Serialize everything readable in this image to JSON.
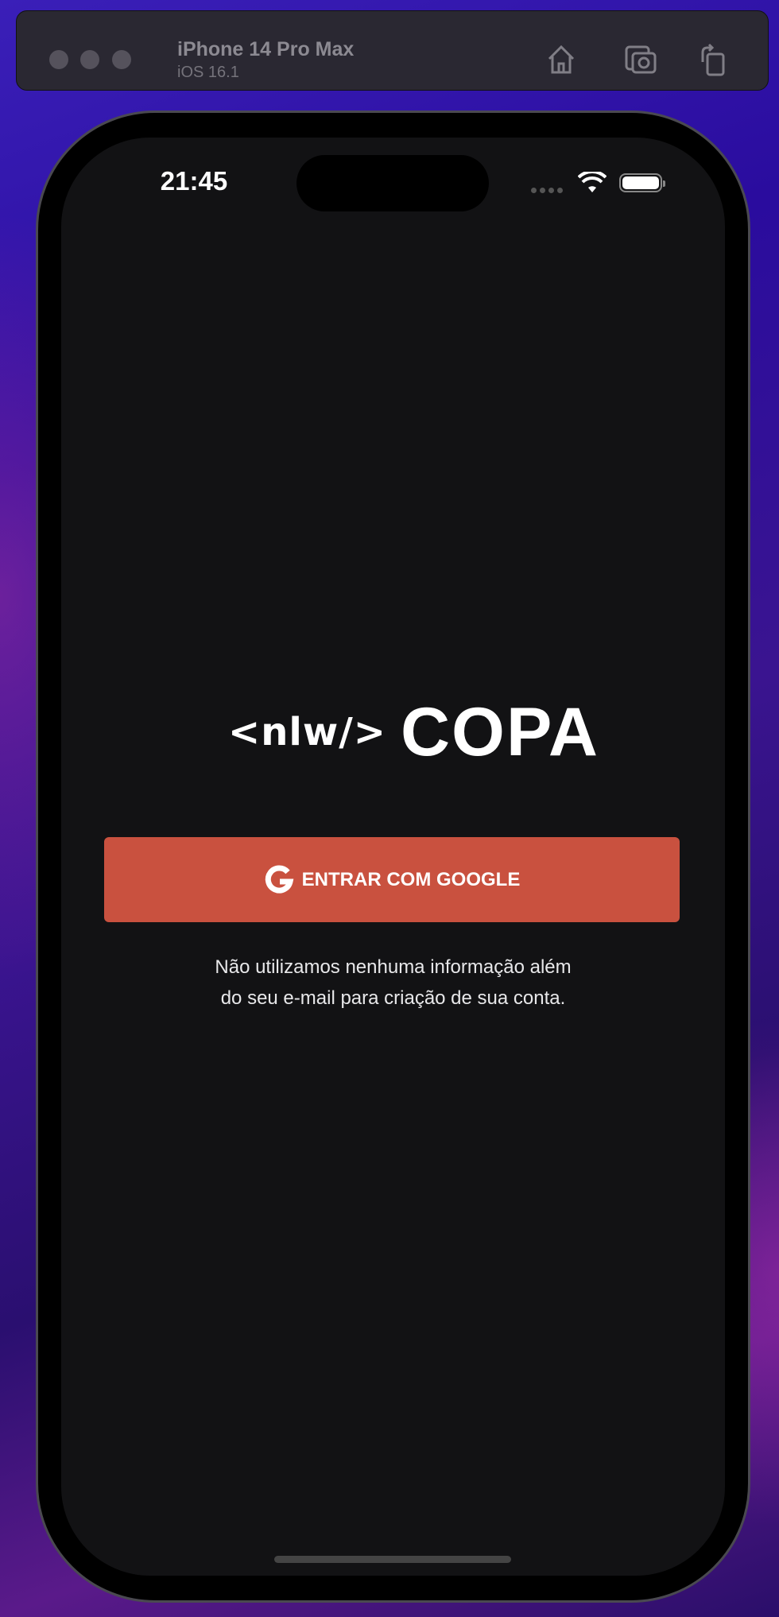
{
  "simulator": {
    "device_name": "iPhone 14 Pro Max",
    "os_version": "iOS 16.1",
    "icons": [
      "home-icon",
      "screenshot-icon",
      "rotate-icon"
    ]
  },
  "status_bar": {
    "time": "21:45"
  },
  "logo": {
    "prefix": "<nlw/>",
    "name": "COPA"
  },
  "login": {
    "google_button_label": "ENTRAR COM GOOGLE",
    "caption_line1": "Não utilizamos nenhuma informação além",
    "caption_line2": "do seu e-mail para criação de sua conta."
  },
  "colors": {
    "accent": "#C9513F",
    "background": "#121214"
  }
}
